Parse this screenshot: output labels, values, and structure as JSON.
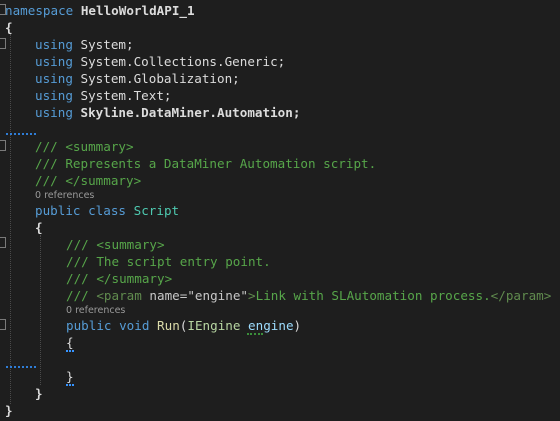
{
  "editor": {
    "lines": {
      "l1": {
        "kw": "namespace",
        "name": "HelloWorldAPI_1"
      },
      "l2": {
        "brace": "{"
      },
      "l3": {
        "kw": "using",
        "ns": "System;"
      },
      "l4": {
        "kw": "using",
        "ns": "System.Collections.Generic;"
      },
      "l5": {
        "kw": "using",
        "ns": "System.Globalization;"
      },
      "l6": {
        "kw": "using",
        "ns": "System.Text;"
      },
      "l7": {
        "kw": "using",
        "ns": "Skyline.DataMiner.Automation;"
      },
      "l9": {
        "text": "/// <summary>"
      },
      "l10": {
        "text": "/// Represents a DataMiner Automation script."
      },
      "l11": {
        "text": "/// </summary>"
      },
      "lens1": "0 references",
      "l12": {
        "kw1": "public",
        "kw2": "class",
        "cls": "Script"
      },
      "l13": {
        "brace": "{"
      },
      "l14": {
        "text": "/// <summary>"
      },
      "l15": {
        "text": "/// The script entry point."
      },
      "l16": {
        "text": "/// </summary>"
      },
      "l17": {
        "prefix": "/// ",
        "tag_open": "<param ",
        "attr": "name=",
        "val": "\"engine\"",
        "tag_close": ">",
        "text": "Link with SLAutomation process.",
        "end_tag": "</param>"
      },
      "lens2": "0 references",
      "l18": {
        "kw1": "public",
        "kw2": "void",
        "method": "Run",
        "paren_open": "(",
        "type": "IEngine",
        "param": "engine",
        "paren_close": ")"
      },
      "l19": {
        "brace": "{"
      },
      "l21": {
        "brace": "}"
      },
      "l22": {
        "brace": "}"
      },
      "l23": {
        "brace": "}"
      }
    }
  },
  "colors": {
    "background": "#1e1e1e",
    "keyword": "#569cd6",
    "class": "#4ec9b0",
    "comment": "#57a64a",
    "method": "#dcdcaa",
    "parameter": "#9cdcfe"
  }
}
